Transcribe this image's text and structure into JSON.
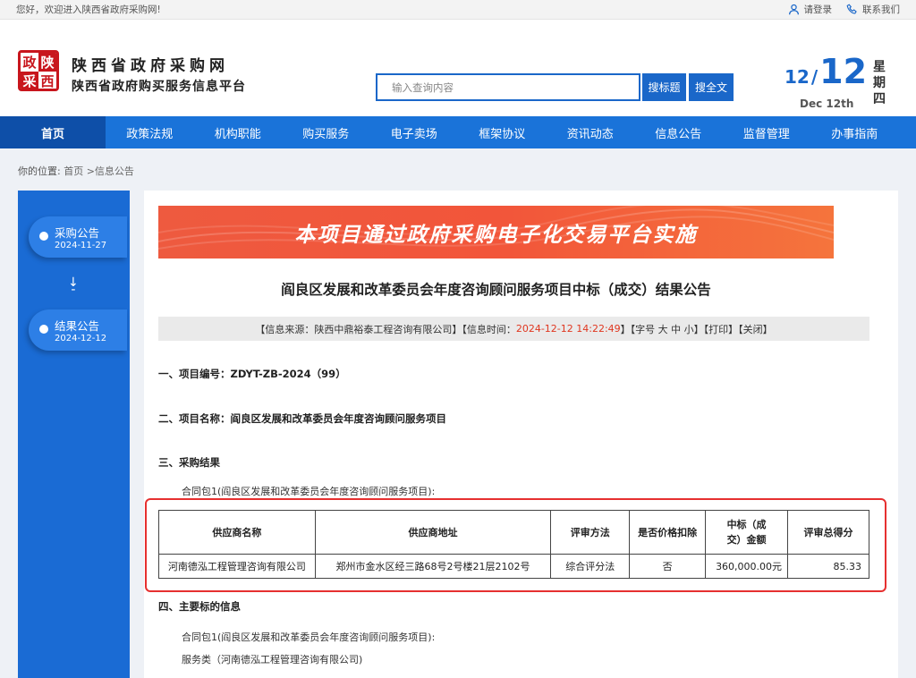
{
  "topbar": {
    "welcome": "您好，欢迎进入陕西省政府采购网!",
    "login": "请登录",
    "contact": "联系我们"
  },
  "header": {
    "logo_chars": [
      "政",
      "陕",
      "采",
      "西"
    ],
    "site_name": "陕西省政府采购网",
    "site_sub": "陕西省政府购买服务信息平台",
    "search_placeholder": "输入查询内容",
    "search_title_btn": "搜标题",
    "search_full_btn": "搜全文",
    "date_month": "12",
    "date_slash": "/",
    "date_day": "12",
    "date_en": "Dec 12th",
    "weekday": [
      "星",
      "期",
      "四"
    ]
  },
  "nav": [
    "首页",
    "政策法规",
    "机构职能",
    "购买服务",
    "电子卖场",
    "框架协议",
    "资讯动态",
    "信息公告",
    "监督管理",
    "办事指南"
  ],
  "breadcrumb": {
    "label": "你的位置:",
    "path": "首页 >信息公告"
  },
  "sidebar": {
    "steps": [
      {
        "name": "采购公告",
        "date": "2024-11-27"
      },
      {
        "name": "结果公告",
        "date": "2024-12-12"
      }
    ],
    "arrow": "↓"
  },
  "article": {
    "banner": "本项目通过政府采购电子化交易平台实施",
    "title": "阎良区发展和改革委员会年度咨询顾问服务项目中标（成交）结果公告",
    "meta_source": "【信息来源：陕西中鼎裕泰工程咨询有限公司】【信息时间：",
    "meta_time": "2024-12-12 14:22:49",
    "meta_rest": "】【字号 大 中 小】【打印】【关闭】",
    "s1": "一、项目编号：ZDYT-ZB-2024（99）",
    "s2": "二、项目名称：阎良区发展和改革委员会年度咨询顾问服务项目",
    "s3": "三、采购结果",
    "s3_sub": "合同包1(阎良区发展和改革委员会年度咨询顾问服务项目):",
    "s4": "四、主要标的信息",
    "s4_sub1": "合同包1(阎良区发展和改革委员会年度咨询顾问服务项目):",
    "s4_sub2": "服务类（河南德泓工程管理咨询有限公司)"
  },
  "table": {
    "headers": [
      "供应商名称",
      "供应商地址",
      "评审方法",
      "是否价格扣除",
      "中标（成交）金额",
      "评审总得分"
    ],
    "rows": [
      [
        "河南德泓工程管理咨询有限公司",
        "郑州市金水区经三路68号2号楼21层2102号",
        "综合评分法",
        "否",
        "360,000.00元",
        "85.33"
      ]
    ]
  },
  "colors": {
    "brand_blue": "#1a73d9",
    "nav_active": "#0e4fa8",
    "accent_red": "#e0361f",
    "highlight_box": "#e63030"
  }
}
